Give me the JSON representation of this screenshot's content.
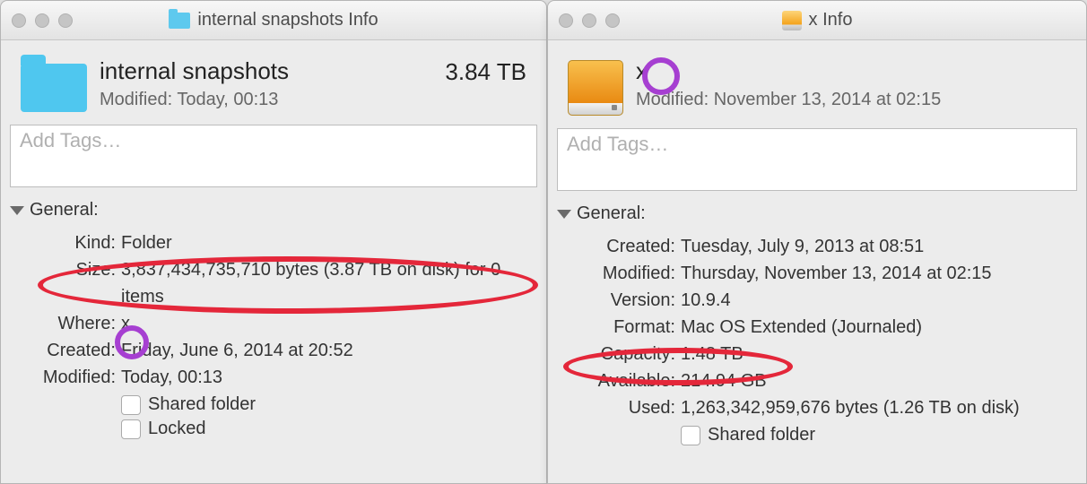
{
  "left": {
    "title": "internal snapshots Info",
    "itemName": "internal snapshots",
    "size": "3.84 TB",
    "modified": "Modified: Today, 00:13",
    "tagsPlaceholder": "Add Tags…",
    "generalLabel": "General:",
    "kind": {
      "label": "Kind:",
      "value": "Folder"
    },
    "sizeRow": {
      "label": "Size:",
      "value": "3,837,434,735,710 bytes (3.87 TB on disk) for 0 items"
    },
    "where": {
      "label": "Where:",
      "value": "x"
    },
    "created": {
      "label": "Created:",
      "value": "Friday, June 6, 2014 at 20:52"
    },
    "modifiedRow": {
      "label": "Modified:",
      "value": "Today, 00:13"
    },
    "sharedFolder": "Shared folder",
    "locked": "Locked"
  },
  "right": {
    "title": "x Info",
    "itemName": "x",
    "modified": "Modified: November 13, 2014 at 02:15",
    "tagsPlaceholder": "Add Tags…",
    "generalLabel": "General:",
    "created": {
      "label": "Created:",
      "value": "Tuesday, July 9, 2013 at 08:51"
    },
    "modifiedRow": {
      "label": "Modified:",
      "value": "Thursday, November 13, 2014 at 02:15"
    },
    "version": {
      "label": "Version:",
      "value": "10.9.4"
    },
    "format": {
      "label": "Format:",
      "value": "Mac OS Extended (Journaled)"
    },
    "capacity": {
      "label": "Capacity:",
      "value": "1.48 TB"
    },
    "available": {
      "label": "Available:",
      "value": "214.94 GB"
    },
    "used": {
      "label": "Used:",
      "value": "1,263,342,959,676 bytes (1.26 TB on disk)"
    },
    "sharedFolder": "Shared folder"
  }
}
